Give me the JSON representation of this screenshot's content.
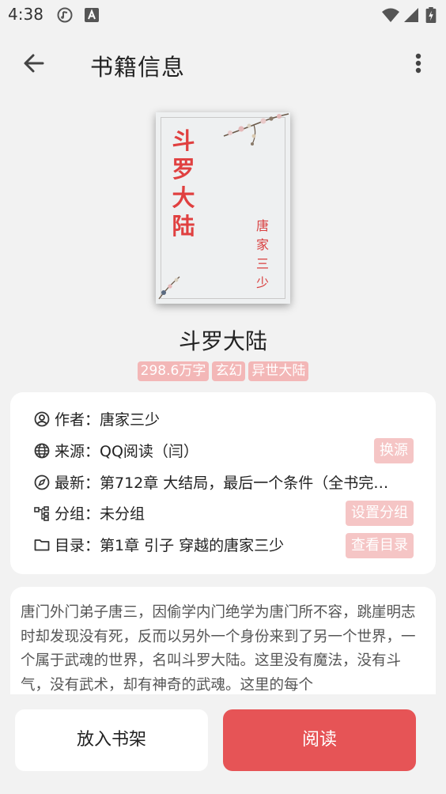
{
  "status": {
    "time": "4:38"
  },
  "appbar": {
    "title": "书籍信息"
  },
  "cover": {
    "title": "斗罗大陆",
    "author": "唐家三少"
  },
  "book": {
    "name": "斗罗大陆",
    "tags": [
      "298.6万字",
      "玄幻",
      "异世大陆"
    ]
  },
  "info": {
    "author": "作者：唐家三少",
    "source": "来源：QQ阅读（闫）",
    "source_btn": "换源",
    "latest": "最新：第712章 大结局，最后一个条件（全书完…",
    "group": "分组：未分组",
    "group_btn": "设置分组",
    "toc": "目录：第1章 引子 穿越的唐家三少",
    "toc_btn": "查看目录"
  },
  "description": "唐门外门弟子唐三，因偷学内门绝学为唐门所不容，跳崖明志时却发现没有死，反而以另外一个身份来到了另一个世界，一个属于武魂的世界，名叫斗罗大陆。这里没有魔法，没有斗气，没有武术，却有神奇的武魂。这里的每个",
  "actions": {
    "shelf": "放入书架",
    "read": "阅读"
  },
  "colors": {
    "accent": "#e65456",
    "tag": "#f3b7b7",
    "cover_title": "#e04040"
  }
}
